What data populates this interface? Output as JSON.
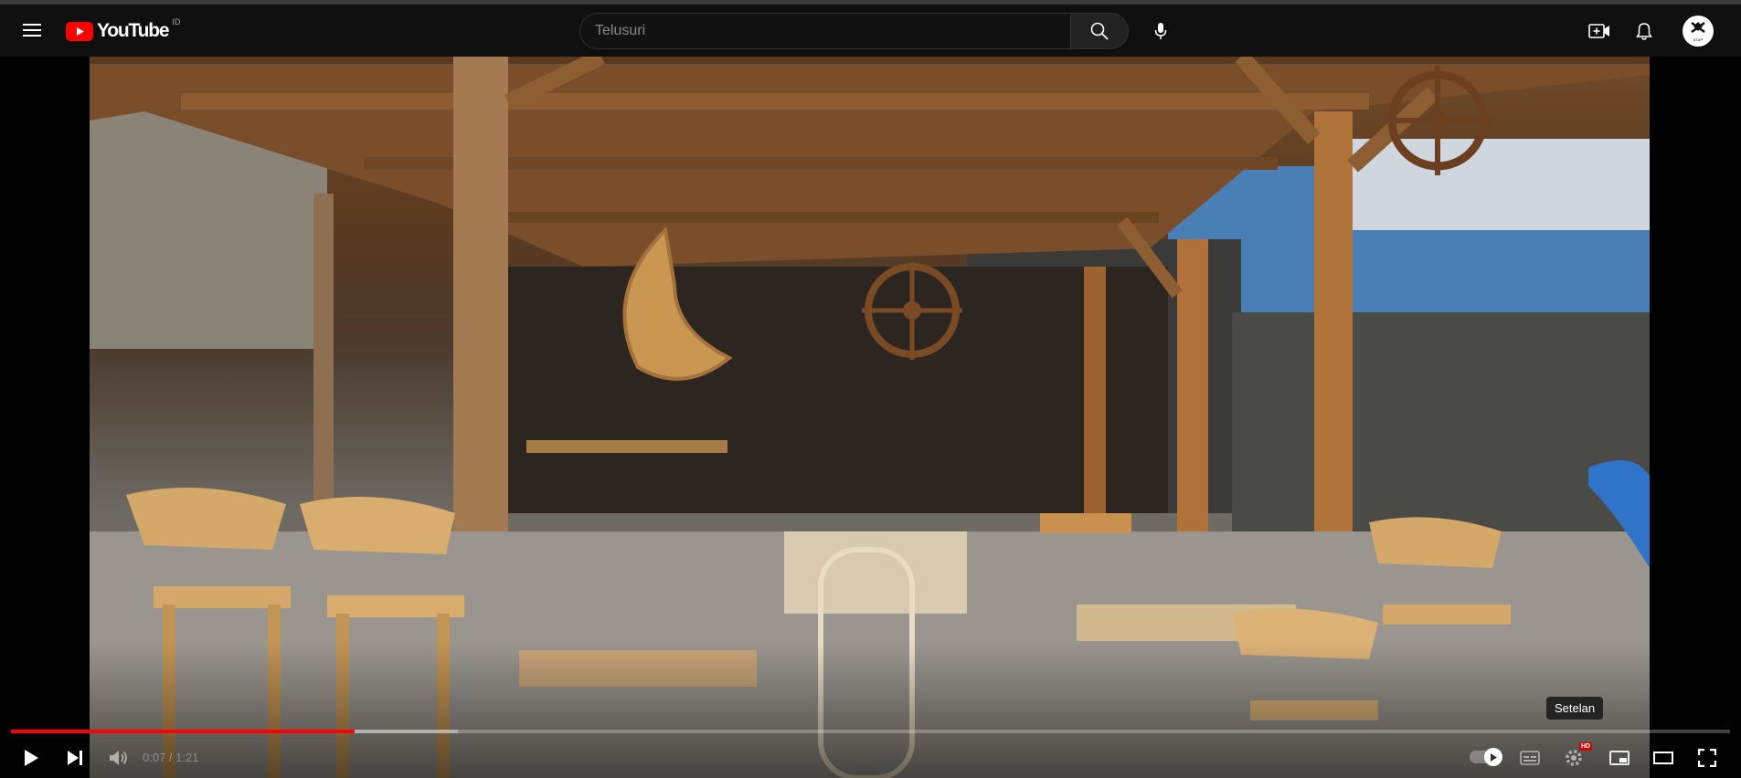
{
  "masthead": {
    "logo_text": "YouTube",
    "country_code": "ID",
    "search": {
      "placeholder": "Telusuri",
      "value": ""
    },
    "avatar_text": "ATAP"
  },
  "player": {
    "time_display": "0:07 / 1:21",
    "progress_played_fraction": 0.2,
    "progress_loaded_fraction": 0.26,
    "tooltip": "Setelan",
    "hd_badge": "HD"
  },
  "colors": {
    "background": "#0f0f0f",
    "progress_red": "#ff0000",
    "logo_red": "#ff0000"
  }
}
